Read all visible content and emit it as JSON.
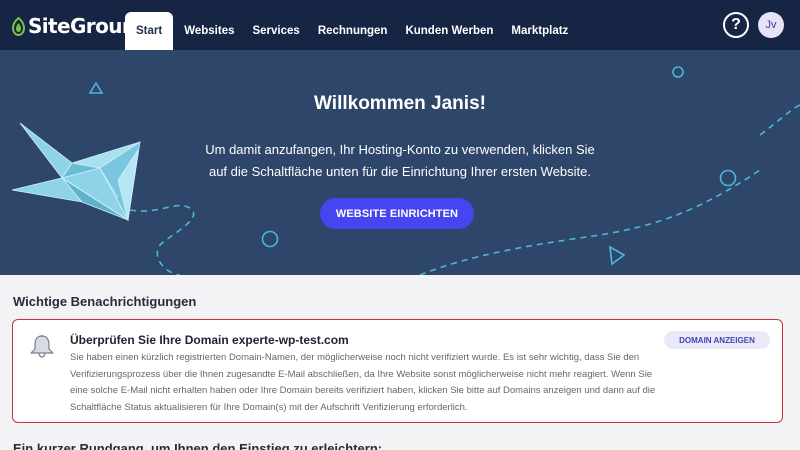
{
  "nav": {
    "brand": "SiteGround",
    "tabs": [
      "Start",
      "Websites",
      "Services",
      "Rechnungen",
      "Kunden Werben",
      "Marktplatz"
    ],
    "active_tab": "Start",
    "help_label": "?",
    "avatar_initials": "Jv"
  },
  "hero": {
    "title": "Willkommen Janis!",
    "text": "Um damit anzufangen, Ihr Hosting-Konto zu verwenden, klicken Sie auf die Schaltfläche unten für die Einrichtung Ihrer ersten Website.",
    "button_label": "WEBSITE EINRICHTEN"
  },
  "notifications": {
    "heading": "Wichtige Benachrichtigungen",
    "items": [
      {
        "icon": "bell-icon",
        "title": "Überprüfen Sie Ihre Domain experte-wp-test.com",
        "body": "Sie haben einen kürzlich registrierten Domain-Namen, der möglicherweise noch nicht verifiziert wurde. Es ist sehr wichtig, dass Sie den Verifizierungsprozess über die Ihnen zugesandte E-Mail abschließen, da Ihre Website sonst möglicherweise nicht mehr reagiert. Wenn Sie eine solche E-Mail nicht erhalten haben oder Ihre Domain bereits verifiziert haben, klicken Sie bitte auf Domains anzeigen und dann auf die Schaltfläche Status aktualisieren für Ihre Domain(s) mit der Aufschrift Verifizierung erforderlich.",
        "button_label": "DOMAIN ANZEIGEN"
      }
    ]
  },
  "tour": {
    "heading": "Ein kurzer Rundgang, um Ihnen den Einstieg zu erleichtern:"
  },
  "colors": {
    "nav_bg": "#172545",
    "hero_bg": "#2d4669",
    "accent": "#4645f0",
    "alert_border": "#c8343a",
    "crane": "#8fd3e8"
  }
}
